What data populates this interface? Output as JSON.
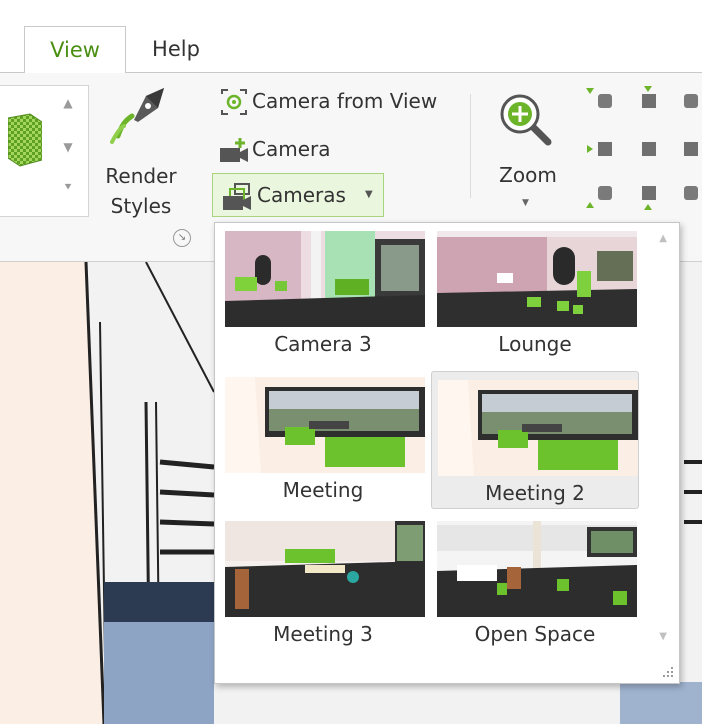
{
  "tabs": [
    {
      "label": "View",
      "active": true
    },
    {
      "label": "Help",
      "active": false
    }
  ],
  "ribbon": {
    "render_styles": {
      "line1": "Render",
      "line2": "Styles"
    },
    "camera_from_view": "Camera from View",
    "camera": "Camera",
    "cameras": "Cameras",
    "zoom": "Zoom"
  },
  "cameras_menu": {
    "items": [
      {
        "name": "Camera 3",
        "scene": "office"
      },
      {
        "name": "Lounge",
        "scene": "lounge"
      },
      {
        "name": "Meeting",
        "scene": "meeting"
      },
      {
        "name": "Meeting 2",
        "scene": "meeting",
        "selected": true
      },
      {
        "name": "Meeting 3",
        "scene": "meeting3"
      },
      {
        "name": "Open Space",
        "scene": "openspace"
      }
    ]
  },
  "colors": {
    "accent": "#6cb52a",
    "tab_active_text": "#4a8f12",
    "button_hover_bg": "#eaf6dd",
    "selected_item_bg": "#ececec"
  }
}
